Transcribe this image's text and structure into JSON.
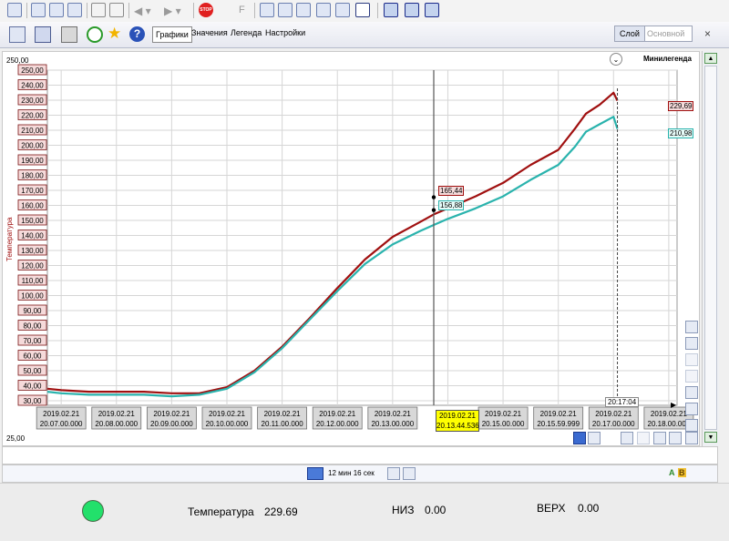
{
  "colors": {
    "series_1": "#a01010",
    "series_2": "#2ab3ad",
    "axis_label_bg": "#f5dada",
    "axis_label_border": "#7a1515",
    "time_label_bg": "#d8d8d8",
    "cursor_label_bg": "#ffff00",
    "status_indicator": "#22e06b"
  },
  "icons": {
    "topbar": [
      "save-icon",
      "window-icon",
      "table-icon",
      "grid-icon",
      "home-icon",
      "tree-up-icon",
      "back-icon",
      "forward-icon",
      "stop-icon",
      "f-icon",
      "trend-icon",
      "list-icon",
      "document-icon",
      "export-icon",
      "report-icon",
      "frame-icon",
      "trend-panel-icon",
      "chart-panel-icon",
      "report-panel-icon"
    ],
    "toolbar": [
      "open-icon",
      "save-icon",
      "print-icon",
      "refresh-icon",
      "favorite-icon",
      "help-icon"
    ]
  },
  "topbar": {
    "stop_label": "STOP",
    "f_label": "F"
  },
  "toolbar": {
    "tabs": [
      "Графики",
      "Значения",
      "Легенда",
      "Настройки"
    ],
    "layer_button": "Слой",
    "layer_value": "Основной",
    "close": "×"
  },
  "plot": {
    "y_top_label": "25,00",
    "y_max_label": "250,00",
    "y_axis_title": "Температура",
    "minilegend_label": "Минилегенда",
    "cursor_time_line1": "2019.02.21",
    "cursor_time_line2": "20.13.44.536",
    "current_time": "20:17:04",
    "value_marker_1": "229,69",
    "value_marker_2": "210,98",
    "cursor_value_1": "165,44",
    "cursor_value_2": "156,88"
  },
  "chart_data": {
    "type": "line",
    "ylabel": "Температура",
    "ylim": [
      25,
      250
    ],
    "y_ticks": [
      "250,00",
      "240,00",
      "230,00",
      "220,00",
      "210,00",
      "200,00",
      "190,00",
      "180,00",
      "170,00",
      "160,00",
      "150,00",
      "140,00",
      "130,00",
      "120,00",
      "110,00",
      "100,00",
      "90,00",
      "80,00",
      "70,00",
      "60,00",
      "50,00",
      "40,00",
      "30,00"
    ],
    "x_ticks": [
      "2019.02.21\n20.07.00.000",
      "2019.02.21\n20.08.00.000",
      "2019.02.21\n20.09.00.000",
      "2019.02.21\n20.10.00.000",
      "2019.02.21\n20.11.00.000",
      "2019.02.21\n20.12.00.000",
      "2019.02.21\n20.13.00.000",
      "2019.02.21\n20.15.00.000",
      "2019.02.21\n20.15.59.999",
      "2019.02.21\n20.17.00.000",
      "2019.02.21\n20.18.00.000"
    ],
    "x_minutes": [
      6.75,
      7.0,
      7.5,
      8.0,
      8.5,
      9.0,
      9.5,
      10.0,
      10.5,
      11.0,
      11.5,
      12.0,
      12.5,
      13.0,
      13.5,
      13.745,
      14.0,
      14.5,
      15.0,
      15.5,
      16.0,
      16.3,
      16.5,
      16.75,
      17.0,
      17.07
    ],
    "series": [
      {
        "values": [
          38,
          37,
          36,
          36,
          36,
          35,
          35,
          39,
          50,
          66,
          85,
          105,
          124,
          139,
          149,
          154,
          158,
          166,
          175,
          187,
          197,
          211,
          221,
          227,
          235,
          229.69
        ]
      },
      {
        "values": [
          36,
          35,
          34,
          34,
          34,
          33,
          34,
          38,
          49,
          65,
          84,
          103,
          121,
          134,
          143,
          147,
          151,
          158,
          166,
          177,
          187,
          199,
          209,
          214,
          219,
          210.98
        ]
      }
    ],
    "cursor_values": {
      "time": "20.13.44.536",
      "values": [
        165.44,
        156.88
      ]
    },
    "grid": true
  },
  "time_window": {
    "duration": "12 мин 16 сек"
  },
  "status": {
    "a_label": "A",
    "b_label": "B"
  },
  "bottom": {
    "temp_label": "Температура",
    "temp_value": "229.69",
    "low_label": "НИЗ",
    "low_value": "0.00",
    "high_label": "ВЕРХ",
    "high_value": "0.00"
  }
}
